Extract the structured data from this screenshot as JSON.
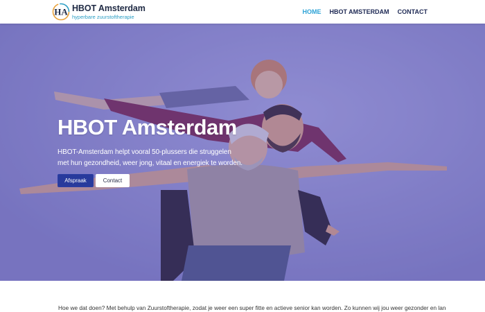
{
  "header": {
    "logo_title": "HBOT Amsterdam",
    "logo_subtitle": "hyperbare zuurstoftherapie",
    "logo_mark": "HA",
    "nav": [
      {
        "label": "HOME",
        "active": true
      },
      {
        "label": "HBOT AMSTERDAM",
        "active": false
      },
      {
        "label": "CONTACT",
        "active": false
      }
    ],
    "active_color": "#2ea3d6"
  },
  "hero": {
    "title": "HBOT Amsterdam",
    "line1": "HBOT-Amsterdam helpt vooral 50-plussers die struggelen",
    "line2": "met hun gezondheid, weer jong, vitaal en energiek te worden.",
    "buttons": {
      "primary": "Afspraak",
      "secondary": "Contact"
    },
    "overlay_color": "#5246be",
    "image_icon": "family-photo"
  },
  "intro": {
    "text": "Hoe we dat doen? Met behulp van Zuurstoftherapie, zodat je weer een super fitte en actieve senior kan worden. Zo kunnen wij jou weer gezonder en langer"
  }
}
